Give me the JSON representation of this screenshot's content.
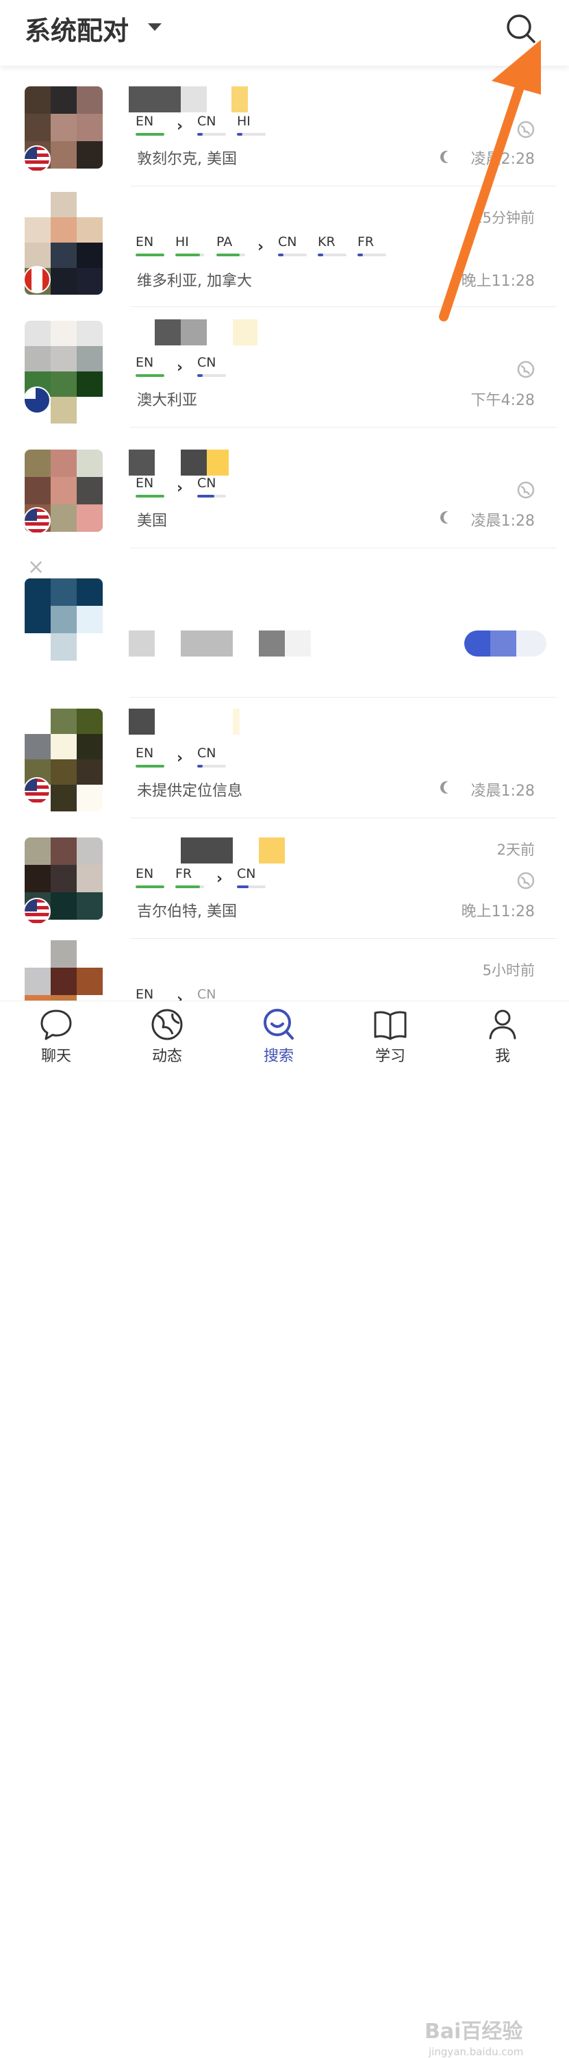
{
  "header": {
    "title": "系统配对",
    "accent": "#3f51b5"
  },
  "rows": [
    {
      "langs_native": [
        "EN"
      ],
      "langs_learning": [
        "CN",
        "HI"
      ],
      "location": "敦刻尔克, 美国",
      "time_ago": "",
      "time": "凌晨2:28",
      "night": true,
      "flag": "us"
    },
    {
      "langs_native": [
        "EN",
        "HI",
        "PA"
      ],
      "langs_learning": [
        "CN",
        "KR",
        "FR"
      ],
      "location": "维多利亚, 加拿大",
      "time_ago": "15分钟前",
      "time": "晚上11:28",
      "night": false,
      "flag": "ca"
    },
    {
      "langs_native": [
        "EN"
      ],
      "langs_learning": [
        "CN"
      ],
      "location": "澳大利亚",
      "time_ago": "",
      "time": "下午4:28",
      "night": false,
      "flag": "au"
    },
    {
      "langs_native": [
        "EN"
      ],
      "langs_learning": [
        "CN"
      ],
      "location": "美国",
      "time_ago": "",
      "time": "凌晨1:28",
      "night": true,
      "flag": "us"
    },
    {
      "langs_native": [
        "EN"
      ],
      "langs_learning": [
        "CN"
      ],
      "location": "未提供定位信息",
      "time_ago": "",
      "time": "凌晨1:28",
      "night": true,
      "flag": "us"
    },
    {
      "langs_native": [
        "EN",
        "FR"
      ],
      "langs_learning": [
        "CN"
      ],
      "location": "吉尔伯特, 美国",
      "time_ago": "2天前",
      "time": "晚上11:28",
      "night": false,
      "flag": "us"
    },
    {
      "langs_native": [
        "EN"
      ],
      "langs_learning": [
        "CN"
      ],
      "location": "",
      "time_ago": "5小时前",
      "time": "",
      "night": false,
      "flag": ""
    }
  ],
  "ad": {
    "close_label": "×"
  },
  "tabs": [
    {
      "label": "聊天",
      "icon": "chat-icon"
    },
    {
      "label": "动态",
      "icon": "globe-icon"
    },
    {
      "label": "搜索",
      "icon": "search-smile-icon",
      "active": true
    },
    {
      "label": "学习",
      "icon": "book-icon"
    },
    {
      "label": "我",
      "icon": "person-icon"
    }
  ],
  "watermark": {
    "text": "Bai百经验",
    "url": "jingyan.baidu.com"
  }
}
